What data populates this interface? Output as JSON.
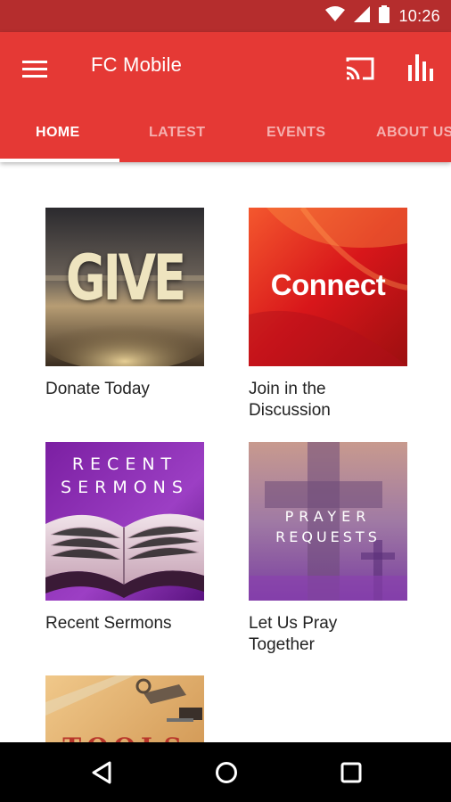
{
  "status_bar": {
    "time": "10:26"
  },
  "app_bar": {
    "title": "FC Mobile"
  },
  "tabs": [
    {
      "label": "HOME",
      "active": true
    },
    {
      "label": "LATEST",
      "active": false
    },
    {
      "label": "EVENTS",
      "active": false
    },
    {
      "label": "ABOUT US",
      "active": false
    }
  ],
  "tiles": [
    {
      "image_text": "GIVE",
      "label_line1": "Donate Today",
      "label_line2": ""
    },
    {
      "image_text": "Connect",
      "label_line1": "Join in the",
      "label_line2": "Discussion"
    },
    {
      "image_text_line1": "RECENT",
      "image_text_line2": "SERMONS",
      "label_line1": "Recent Sermons",
      "label_line2": ""
    },
    {
      "image_text_line1": "PRAYER",
      "image_text_line2": "REQUESTS",
      "label_line1": "Let Us Pray",
      "label_line2": "Together"
    },
    {
      "image_text": "TOOLS",
      "label_line1": "",
      "label_line2": ""
    }
  ],
  "colors": {
    "primary": "#e53935",
    "status_bar": "#b52d2d",
    "nav_bar": "#000000"
  },
  "icons": [
    "wifi-icon",
    "signal-icon",
    "battery-icon",
    "menu-icon",
    "cast-icon",
    "bar-chart-icon",
    "back-icon",
    "home-icon",
    "recents-icon"
  ]
}
